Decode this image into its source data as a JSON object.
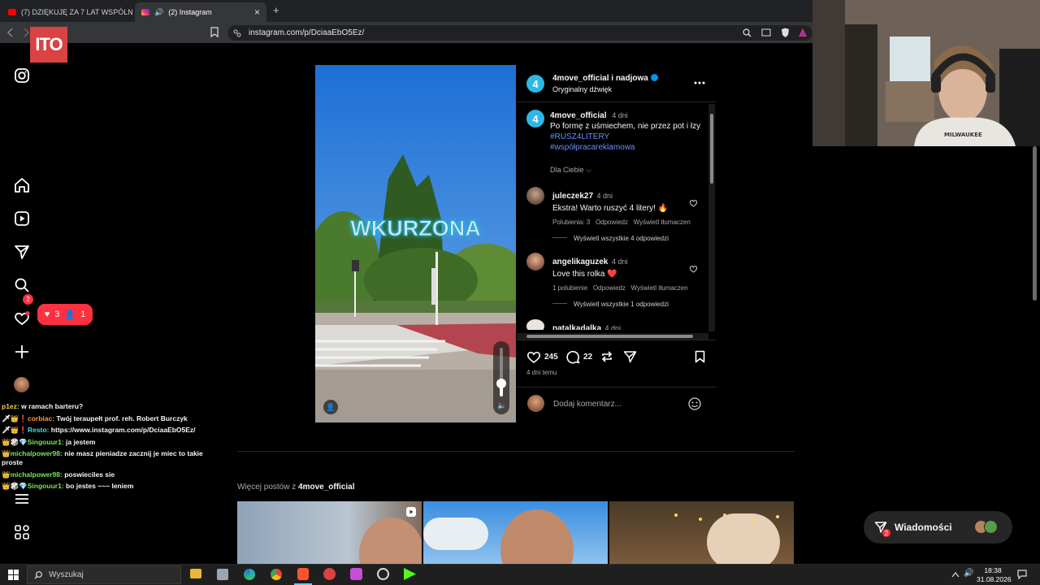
{
  "browser": {
    "tabs": [
      {
        "label": "(7) DZIĘKUJĘ ZA 7 LAT WSPÓLNYCH",
        "active": false
      },
      {
        "label": "(2) Instagram",
        "active": true
      }
    ],
    "new_tab": "+",
    "close": "×",
    "url": "instagram.com/p/DciaaEbO5Ez/"
  },
  "sidebar": {
    "notifications_badge": "2",
    "activity_popup": {
      "likes": "3",
      "followers": "1"
    }
  },
  "overlay_logo": "ITO",
  "post": {
    "header": {
      "username": "4move_official",
      "collab": "i nadjowa",
      "audio": "Oryginalny dźwięk"
    },
    "video_text": "WKURZONA",
    "caption": {
      "username": "4move_official",
      "time": "4 dni",
      "text": "Po formę z uśmiechem, nie przez pot i łzy",
      "hashtags": [
        "#RUSZ4LITERY",
        "#współpracareklamowa"
      ]
    },
    "translation_toggle": "Dla Ciebie",
    "comments": [
      {
        "username": "juleczek27",
        "time": "4 dni",
        "text": "Ekstra! Warto ruszyć 4 litery! 🔥",
        "likes": "Polubienia: 3",
        "reply": "Odpowiedz",
        "translate": "Wyświetl tłumaczen",
        "view_replies": "Wyświetl wszystkie 4 odpowiedzi"
      },
      {
        "username": "angelikaguzek",
        "time": "4 dni",
        "text": "Love this rolka ❤️",
        "likes": "1 polubienie",
        "reply": "Odpowiedz",
        "translate": "Wyświetl tłumaczen",
        "view_replies": "Wyświetl wszystkie 1 odpowiedzi"
      },
      {
        "username": "natalkadalka",
        "time": "4 dni"
      }
    ],
    "likes_count": "245",
    "comments_count": "22",
    "posted": "4 dni temu",
    "add_comment_placeholder": "Dodaj komentarz..."
  },
  "more_posts": {
    "label": "Więcej postów z",
    "username": "4move_official"
  },
  "messages": {
    "label": "Wiadomości",
    "badge": "2"
  },
  "chat": [
    {
      "user": "p1ez:",
      "text": "w ramach barteru?",
      "color": "#f2d14a"
    },
    {
      "user": "corbiac:",
      "text": "Twój teraupełt prof. reh. Robert Burczyk",
      "color": "#ff9a3c"
    },
    {
      "user": "Resto:",
      "text": "https://www.instagram.com/p/DciaaEbO5Ez/",
      "color": "#54d6e0"
    },
    {
      "user": "Singouur1:",
      "text": "ja jestem",
      "color": "#7ce35b"
    },
    {
      "user": "michalpower98:",
      "text": "nie masz pieniadze zacznij je miec to takie proste",
      "color": "#7ce35b"
    },
    {
      "user": "michalpower98:",
      "text": "poswieciles sie",
      "color": "#7ce35b"
    },
    {
      "user": "Singouur1:",
      "text": "bo jestes ~~~ leniem",
      "color": "#7ce35b"
    }
  ],
  "taskbar": {
    "search": "Wyszukaj",
    "time": "18:38",
    "date": "31.08.2026"
  },
  "colors": {
    "accent": "#0095f6",
    "notification": "#ff3040",
    "link": "#6a8ff8"
  }
}
